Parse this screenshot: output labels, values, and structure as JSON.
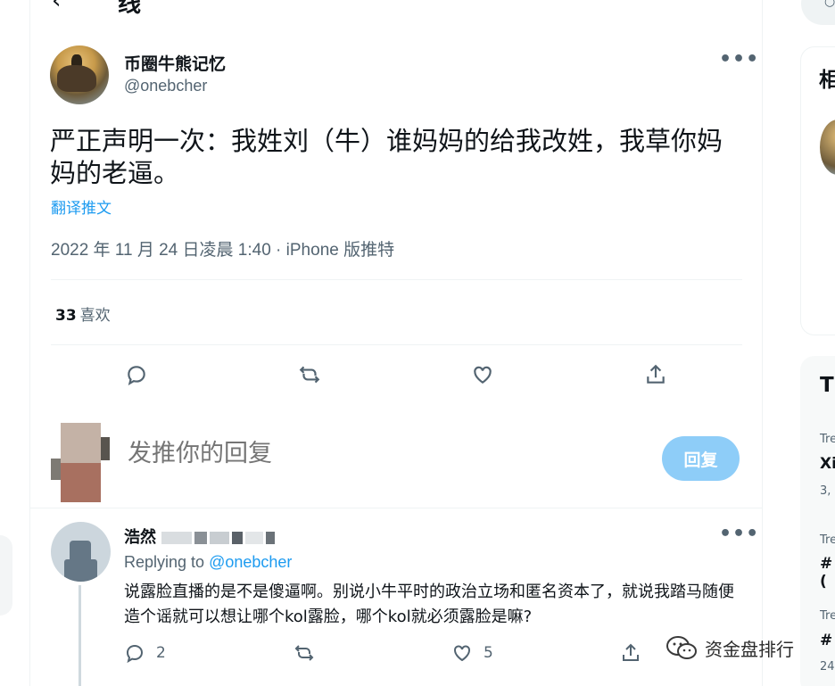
{
  "header": {
    "title": "线",
    "back_icon": "arrow-left-icon"
  },
  "tweet": {
    "author_name": "币圈牛熊记忆",
    "author_handle": "@onebcher",
    "text": "严正声明一次：我姓刘（牛）谁妈妈的给我改姓，我草你妈妈的老逼。",
    "translate_label": "翻译推文",
    "meta": "2022 年 11 月 24 日凌晨 1:40 · iPhone 版推特",
    "likes_count": "33",
    "likes_label": "喜欢"
  },
  "compose": {
    "placeholder": "发推你的回复",
    "reply_button": "回复"
  },
  "reply": {
    "author_name": "浩然",
    "replying_prefix": "Replying to",
    "replying_handle": "@onebcher",
    "text": "说露脸直播的是不是傻逼啊。别说小牛平时的政治立场和匿名资本了，就说我踏马随便造个谣就可以想让哪个kol露脸，哪个kol就必须露脸是嘛?",
    "reply_count": "2",
    "retweet_count": "",
    "like_count": "5"
  },
  "sidebar": {
    "related_title": "相",
    "trends_title": "T",
    "trends": [
      {
        "category": "Tre",
        "name": "Xi",
        "count": "3,"
      },
      {
        "category": "Tre",
        "name": "#(",
        "count": ""
      },
      {
        "category": "Tre",
        "name": "#",
        "count": "24"
      }
    ]
  },
  "watermark": {
    "text": "资金盘排行"
  },
  "colors": {
    "accent": "#1d9bf0",
    "reply_button_disabled": "#8ecdf8",
    "secondary_text": "#536471"
  }
}
